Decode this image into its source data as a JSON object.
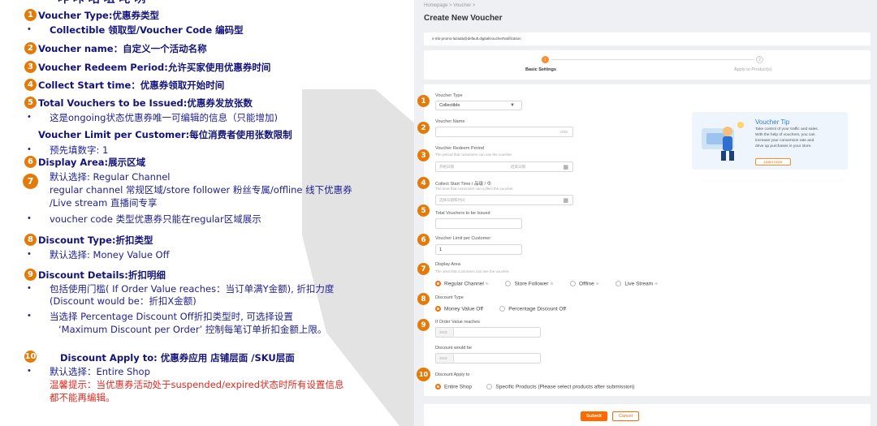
{
  "annotations": {
    "top_partial": "一 咋 咔 咕 咀 咤 咧",
    "items": [
      {
        "n": "1",
        "title": "Voucher Type:优惠券类型",
        "lines": [
          {
            "bullet": true,
            "bold": true,
            "text": "Collectible 领取型/Voucher Code  编码型"
          }
        ]
      },
      {
        "n": "2",
        "title": "Voucher name：自定义一个活动名称"
      },
      {
        "n": "3",
        "title": "Voucher Redeem Period:允许买家使用优惠券时间"
      },
      {
        "n": "4",
        "title": "Collect Start time：优惠券领取开始时间"
      },
      {
        "n": "5",
        "title": "Total Vouchers to be Issued:优惠券发放张数"
      }
    ],
    "l5a": "这是ongoing状态优惠券唯一可编辑的信息（只能增加)",
    "limit_title": "Voucher Limit per Customer:每位消费者使用张数限制",
    "limit_line": "预先填数字: 1",
    "t6": "Display Area:展示区域",
    "l7a": "默认选择: Regular Channel",
    "l7b": "regular channel 常规区域/store follower 粉丝专属/offline 线下优惠券",
    "l7c": "/Live stream 直播间专享",
    "l7d": "voucher code 类型优惠券只能在regular区域展示",
    "t8": "Discount Type:折扣类型",
    "l8": "默认选择: Money Value Off",
    "t9": "Discount Details:折扣明细",
    "l9a": "包括使用门槛( If Order Value reaches：当订单满Y金额), 折扣力度",
    "l9b": "(Discount would be：折扣X金额)",
    "l9c": "当选择 Percentage Discount Off折扣类型时, 可选择设置",
    "l9d": "‘Maximum Discount per Order’  控制每笔订单折扣金额上限。",
    "t10": "Discount Apply to: 优惠券应用 店铺层面 /SKU层面",
    "l10": "默认选择：Entire Shop",
    "warn1": "温馨提示：当优惠券活动处于suspended/expired状态时所有设置信息",
    "warn2": "都不能再编辑。"
  },
  "app": {
    "breadcrumb": "Homepage  >  Voucher  >",
    "title": "Create New Voucher",
    "url": "s-mb-promo-lazada@default.digital/voucherNotification",
    "steps": [
      "Basic Settings",
      "Apply to Product(s)"
    ],
    "voucher_type_label": "Voucher Type",
    "voucher_type_value": "Collectible",
    "voucher_name_label": "Voucher Name",
    "voucher_name_count": "0/40",
    "redeem_label": "Voucher Redeem Period",
    "redeem_help": "The period that customers can use the voucher.",
    "redeem_start": "开始日期",
    "redeem_end": "结束日期",
    "collect_label": "Collect Start Time / 品级 / ⊕",
    "collect_help": "The time that customers can collect the voucher.",
    "collect_placeholder": "选择日期和时间",
    "total_label": "Total Vouchers to be Issued",
    "limit_label": "Voucher Limit per Customer",
    "limit_value": "1",
    "display_label": "Display Area",
    "display_help": "The area that customers can see the voucher.",
    "display_options": [
      "Regular Channel",
      "Store Follower",
      "Offline",
      "Live Stream"
    ],
    "discount_type_label": "Discount Type",
    "discount_types": [
      "Money Value Off",
      "Percentage Discount Off"
    ],
    "order_value_label": "If Order Value reaches",
    "currency": "SGD",
    "discount_label": "Discount would be",
    "apply_label": "Discount Apply to",
    "apply_options": [
      "Entire Shop",
      "Specific Products (Please select products after submission)"
    ],
    "tip_title": "Voucher Tip",
    "tip_text1": "Take control of your traffic and sales.",
    "tip_text2": "With the help of vouchers, you can",
    "tip_text3": "increase your conversion rate and",
    "tip_text4": "drive up purchases in your store.",
    "tip_link": "Learn more",
    "submit": "Submit",
    "cancel": "Cancel",
    "badges": [
      "1",
      "2",
      "3",
      "4",
      "5",
      "6",
      "7",
      "8",
      "9",
      "10"
    ],
    "colors": {
      "accent": "#ff6a00",
      "badge": "#e37b0b"
    }
  }
}
